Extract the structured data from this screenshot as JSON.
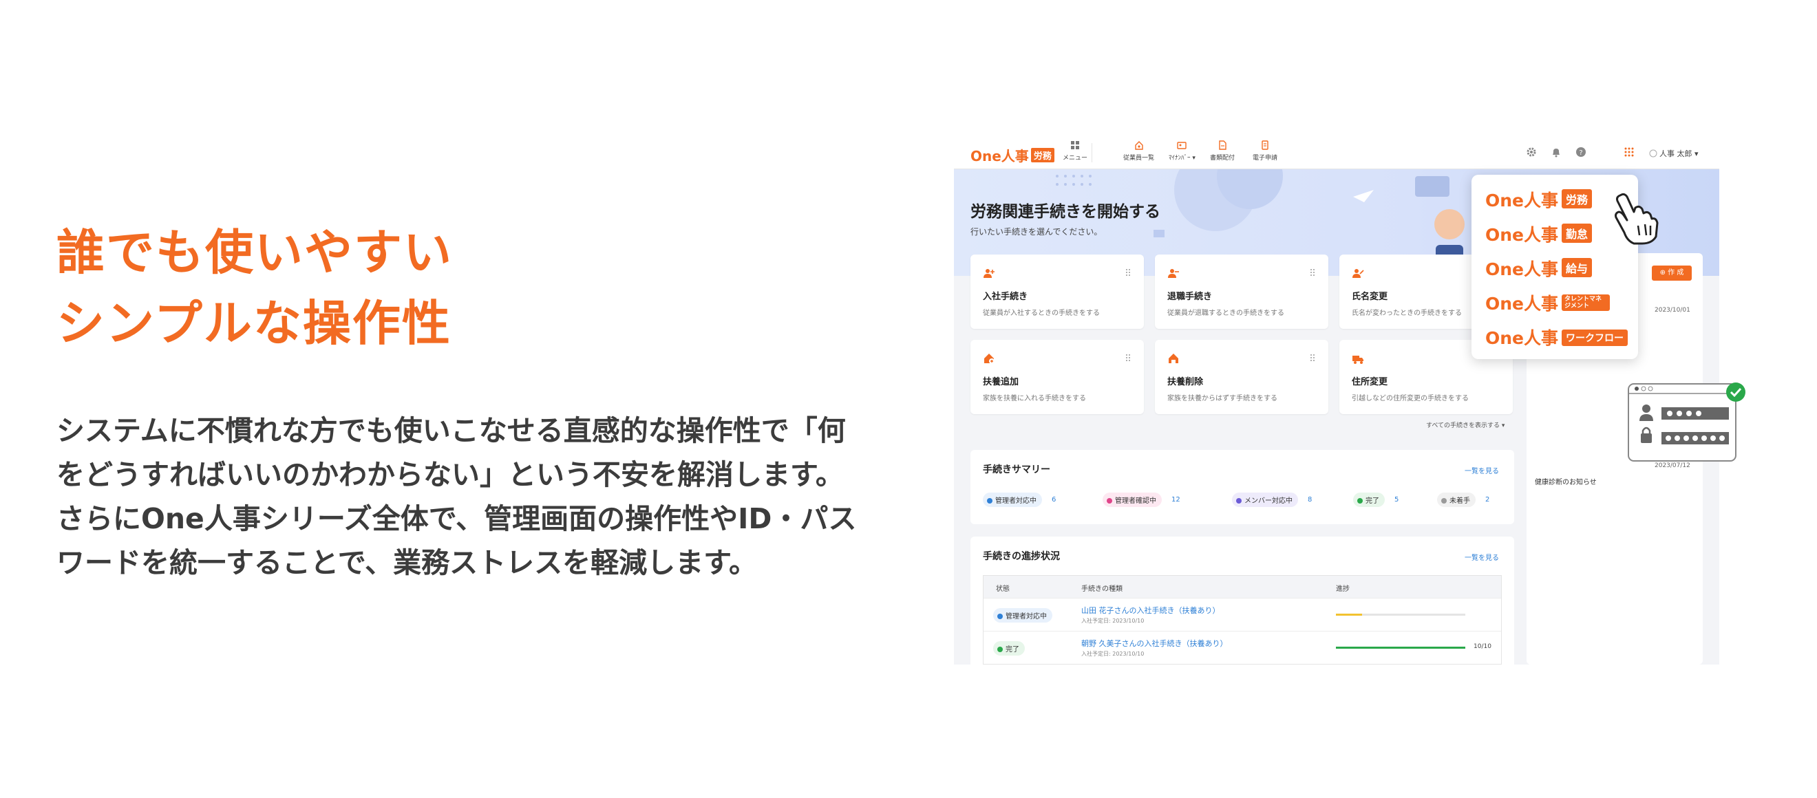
{
  "headline": {
    "line1": "誰でも使いやすい",
    "line2": "シンプルな操作性"
  },
  "body": {
    "line1": "システムに不慣れな方でも使いこなせる直感的な操作性で「何",
    "line2": "をどうすればいいのかわからない」という不安を解消します。",
    "line3": "さらにOne人事シリーズ全体で、管理画面の操作性やID・パス",
    "line4": "ワードを統一することで、業務ストレスを軽減します。"
  },
  "app": {
    "logo": {
      "text": "One人事",
      "tag": "労務"
    },
    "nav": [
      {
        "label": "メニュー",
        "icon": "grid-icon"
      },
      {
        "label": "従業員一覧",
        "icon": "people-icon"
      },
      {
        "label": "ﾏｲﾅﾝﾊﾞｰ ▾",
        "icon": "id-card-icon"
      },
      {
        "label": "書類配付",
        "icon": "document-icon"
      },
      {
        "label": "電子申請",
        "icon": "application-icon"
      }
    ],
    "user_name": "人事 太郎 ▾",
    "hero": {
      "title": "労務関連手続きを開始する",
      "subtitle": "行いたい手続きを選んでください。"
    },
    "cards": [
      {
        "title": "入社手続き",
        "desc": "従業員が入社するときの手続きをする",
        "icon": "user-plus-icon"
      },
      {
        "title": "退職手続き",
        "desc": "従業員が退職するときの手続きをする",
        "icon": "user-minus-icon"
      },
      {
        "title": "氏名変更",
        "desc": "氏名が変わったときの手続きをする",
        "icon": "user-edit-icon"
      },
      {
        "title": "扶養追加",
        "desc": "家族を扶養に入れる手続きをする",
        "icon": "home-plus-icon"
      },
      {
        "title": "扶養削除",
        "desc": "家族を扶養からはずす手続きをする",
        "icon": "home-minus-icon"
      },
      {
        "title": "住所変更",
        "desc": "引越しなどの住所変更の手続きをする",
        "icon": "truck-icon"
      }
    ],
    "show_all": "すべての手続きを表示する ▾",
    "summary": {
      "title": "手続きサマリー",
      "link": "一覧を見る",
      "items": [
        {
          "label": "管理者対応中",
          "count": "6",
          "color": "#2f80d6",
          "bg": "#e8f1fc"
        },
        {
          "label": "管理者確認中",
          "count": "12",
          "color": "#e0458a",
          "bg": "#fde8f1"
        },
        {
          "label": "メンバー対応中",
          "count": "8",
          "color": "#6b5bd6",
          "bg": "#eeebfb"
        },
        {
          "label": "完了",
          "count": "5",
          "color": "#2aa84a",
          "bg": "#e7f6ea"
        },
        {
          "label": "未着手",
          "count": "2",
          "color": "#9a9a9a",
          "bg": "#f1f1f1"
        }
      ]
    },
    "progress": {
      "title": "手続きの進捗状況",
      "link": "一覧を見る",
      "headers": {
        "status": "状態",
        "type": "手続きの種類",
        "progress": "進捗"
      },
      "rows": [
        {
          "status": "管理者対応中",
          "status_color": "#2f80d6",
          "status_bg": "#e8f1fc",
          "name": "山田 花子さんの入社手続き（扶養あり）",
          "date": "入社予定日: 2023/10/10",
          "progress": 0.2,
          "progress_label": "",
          "bar_color": "#f2c230"
        },
        {
          "status": "完了",
          "status_color": "#2aa84a",
          "status_bg": "#e7f6ea",
          "name": "朝野 久美子さんの入社手続き（扶養あり）",
          "date": "入社予定日: 2023/10/10",
          "progress": 1.0,
          "progress_label": "10/10",
          "bar_color": "#2aa84a"
        }
      ]
    },
    "right_panel": {
      "create_label": "⊕ 作 成",
      "date1": "2023/10/01",
      "date2": "2023/07/12",
      "notice": "健康診断のお知らせ"
    },
    "dropdown": [
      {
        "brand": "One人事",
        "tag": "労務",
        "tag_small": false
      },
      {
        "brand": "One人事",
        "tag": "勤怠",
        "tag_small": false
      },
      {
        "brand": "One人事",
        "tag": "給与",
        "tag_small": false
      },
      {
        "brand": "One人事",
        "tag": "タレントマネジメント",
        "tag_small": true
      },
      {
        "brand": "One人事",
        "tag": "ワークフロー",
        "tag_small": false
      }
    ]
  },
  "colors": {
    "accent": "#f26b22",
    "link": "#2f80d6",
    "success": "#2aa84a"
  }
}
